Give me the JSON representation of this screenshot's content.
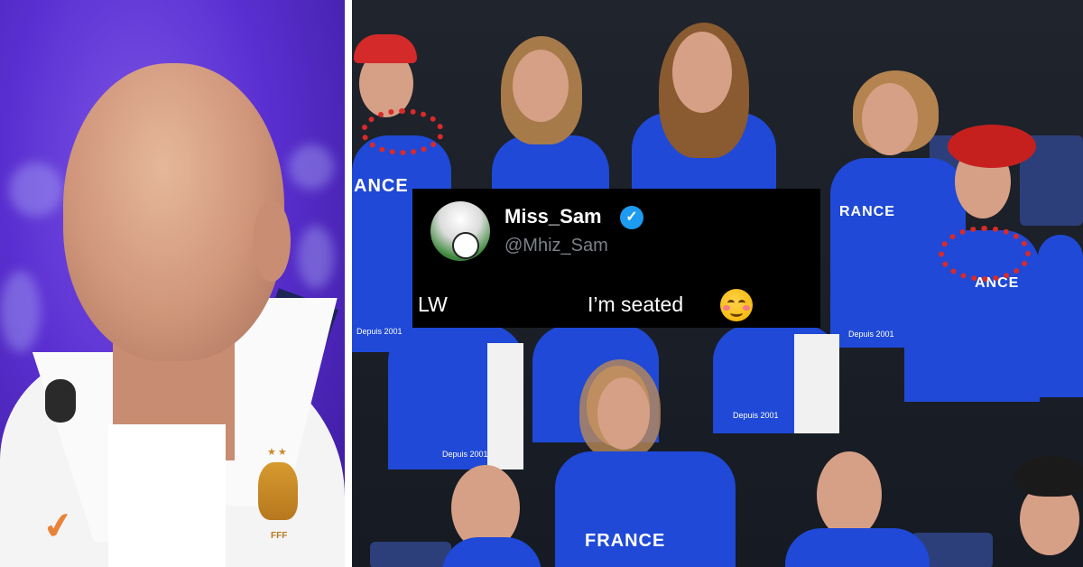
{
  "tweet": {
    "display_name": "Miss_Sam",
    "handle": "@Mhiz_Sam",
    "text_prefix": "LW",
    "text_main": "I’m seated",
    "emoji": "smiling-face-with-blush-emoji",
    "verified_icon": "verified-badge-icon"
  },
  "left_photo": {
    "chest_logo_text": "FFF",
    "stars": "★★"
  },
  "right_photo": {
    "shirt_texts": [
      "FRANCE",
      "ANCE",
      "RANCE",
      "FRANCE",
      "ANCE"
    ],
    "small_texts": [
      "Depuis 2001",
      "Depuis 2001",
      "Depuis 2001",
      "Depuis 2001"
    ]
  },
  "colors": {
    "tweet_bg": "#000000",
    "verified_blue": "#1d9bf0",
    "france_blue": "#1f49d6",
    "backdrop_purple": "#5a2fd1"
  }
}
